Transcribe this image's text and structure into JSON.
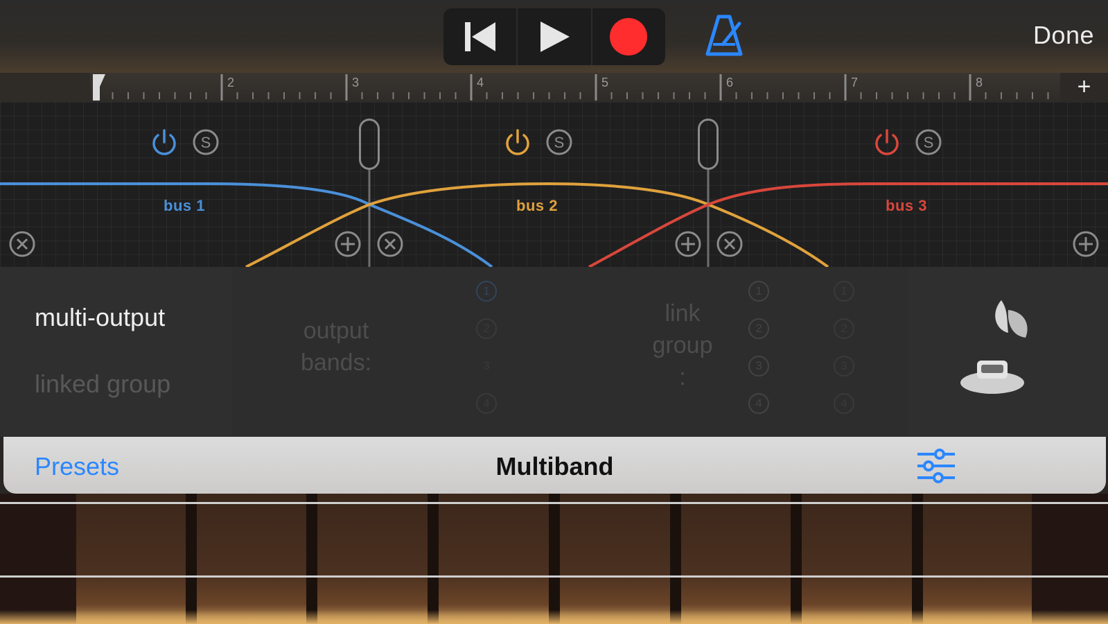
{
  "topbar": {
    "transport": {
      "rewind_icon": "skip-to-start-icon",
      "play_icon": "play-icon",
      "record_icon": "record-icon"
    },
    "metronome_icon": "metronome-icon",
    "done_label": "Done"
  },
  "ruler": {
    "bars": [
      "2",
      "3",
      "4",
      "5",
      "6",
      "7",
      "8"
    ],
    "add_label": "+"
  },
  "graph": {
    "buses": [
      {
        "label": "bus 1",
        "color": "#4a90d9"
      },
      {
        "label": "bus 2",
        "color": "#e0a23c"
      },
      {
        "label": "bus 3",
        "color": "#d9473b"
      }
    ],
    "solo_label": "S"
  },
  "options": {
    "mode_active": "multi-output",
    "mode_inactive": "linked group",
    "output_bands_label": "output\nbands:",
    "link_group_label": "link\ngroup\n:",
    "numbers": [
      "1",
      "2",
      "3",
      "4"
    ]
  },
  "presetbar": {
    "presets_label": "Presets",
    "title": "Multiband",
    "settings_icon": "sliders-icon"
  },
  "colors": {
    "accent": "#2b87ff",
    "record": "#ff2d2d",
    "bus1": "#4a90d9",
    "bus2": "#e0a23c",
    "bus3": "#d9473b"
  }
}
